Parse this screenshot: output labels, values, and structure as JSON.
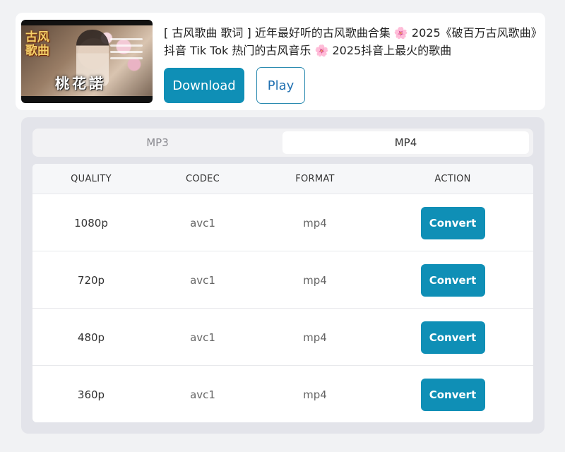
{
  "video": {
    "title": "[ 古风歌曲 歌词 ] 近年最好听的古风歌曲合集 🌸 2025《破百万古风歌曲》抖音 Tik Tok 热门的古风音乐 🌸 2025抖音上最火的歌曲",
    "thumbnail_text_left": "古风歌曲",
    "thumbnail_text_bottom": "桃花諾"
  },
  "actions": {
    "download_label": "Download",
    "play_label": "Play"
  },
  "tabs": [
    {
      "label": "MP3",
      "active": false
    },
    {
      "label": "MP4",
      "active": true
    }
  ],
  "table": {
    "headers": [
      "QUALITY",
      "CODEC",
      "FORMAT",
      "ACTION"
    ],
    "rows": [
      {
        "quality": "1080p",
        "codec": "avc1",
        "format": "mp4",
        "action": "Convert"
      },
      {
        "quality": "720p",
        "codec": "avc1",
        "format": "mp4",
        "action": "Convert"
      },
      {
        "quality": "480p",
        "codec": "avc1",
        "format": "mp4",
        "action": "Convert"
      },
      {
        "quality": "360p",
        "codec": "avc1",
        "format": "mp4",
        "action": "Convert"
      }
    ]
  },
  "colors": {
    "accent": "#0f8fb6",
    "background": "#f1f2f4",
    "panel": "#e3e4ea"
  }
}
